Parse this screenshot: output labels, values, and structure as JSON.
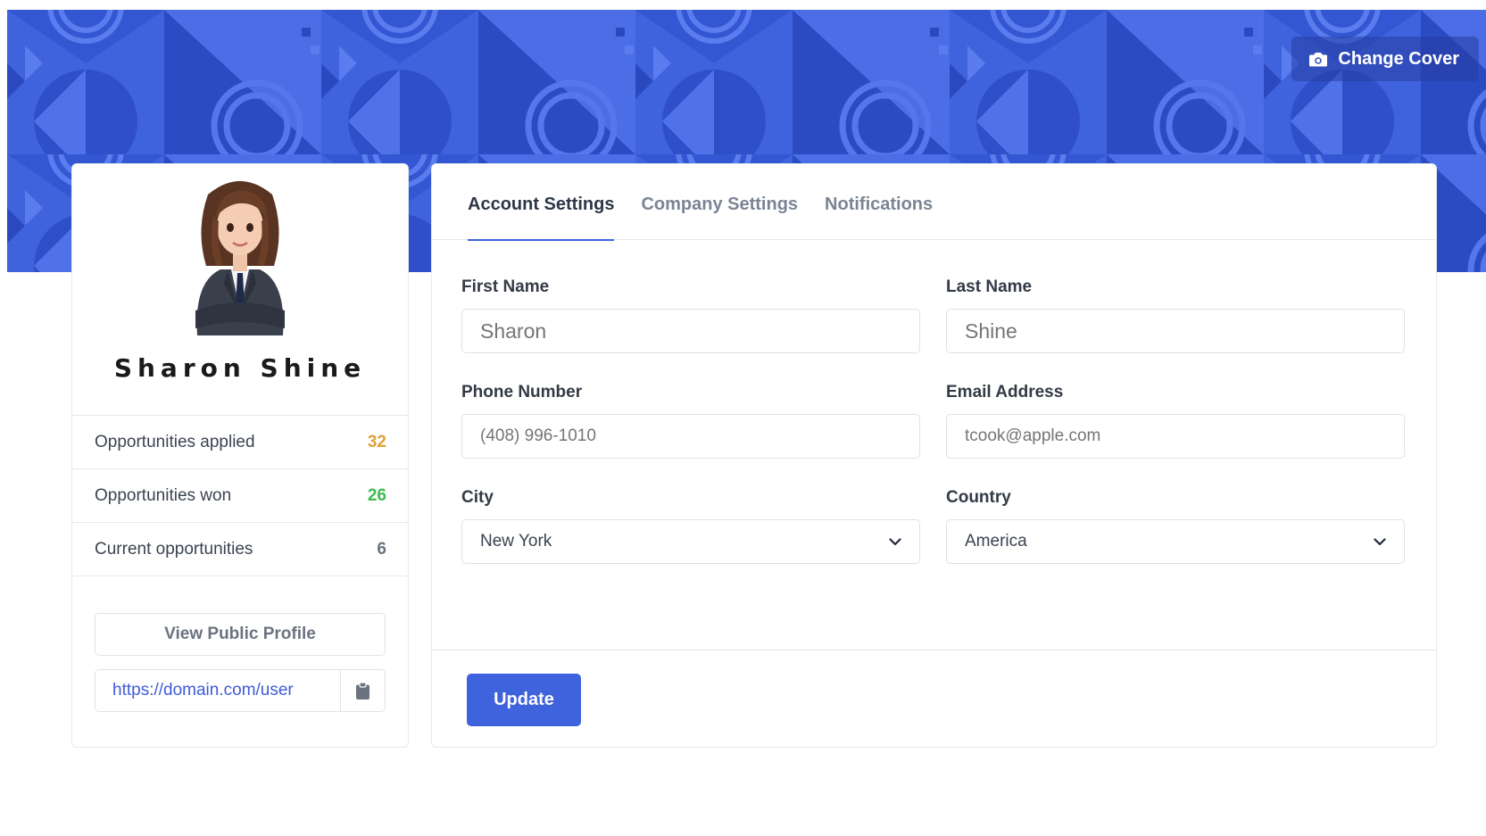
{
  "cover": {
    "change_label": "Change Cover",
    "icon": "camera-icon",
    "color": "#3f62dd"
  },
  "profile": {
    "name": "Sharon Shine",
    "avatar": "avatar",
    "stats": [
      {
        "label": "Opportunities applied",
        "value": "32",
        "color": "#e0a13a"
      },
      {
        "label": "Opportunities won",
        "value": "26",
        "color": "#3dbb4f"
      },
      {
        "label": "Current opportunities",
        "value": "6",
        "color": "#6b7280"
      }
    ],
    "view_profile_label": "View Public Profile",
    "url": "https://domain.com/user",
    "copy_icon": "clipboard-icon"
  },
  "tabs": [
    {
      "label": "Account Settings",
      "active": true
    },
    {
      "label": "Company Settings",
      "active": false
    },
    {
      "label": "Notifications",
      "active": false
    }
  ],
  "form": {
    "first_name": {
      "label": "First Name",
      "placeholder": "Sharon"
    },
    "last_name": {
      "label": "Last Name",
      "placeholder": "Shine"
    },
    "phone": {
      "label": "Phone Number",
      "placeholder": "(408) 996-1010"
    },
    "email": {
      "label": "Email Address",
      "placeholder": "tcook@apple.com"
    },
    "city": {
      "label": "City",
      "value": "New York"
    },
    "country": {
      "label": "Country",
      "value": "America"
    },
    "update_label": "Update"
  },
  "accent_color": "#3f62dd"
}
